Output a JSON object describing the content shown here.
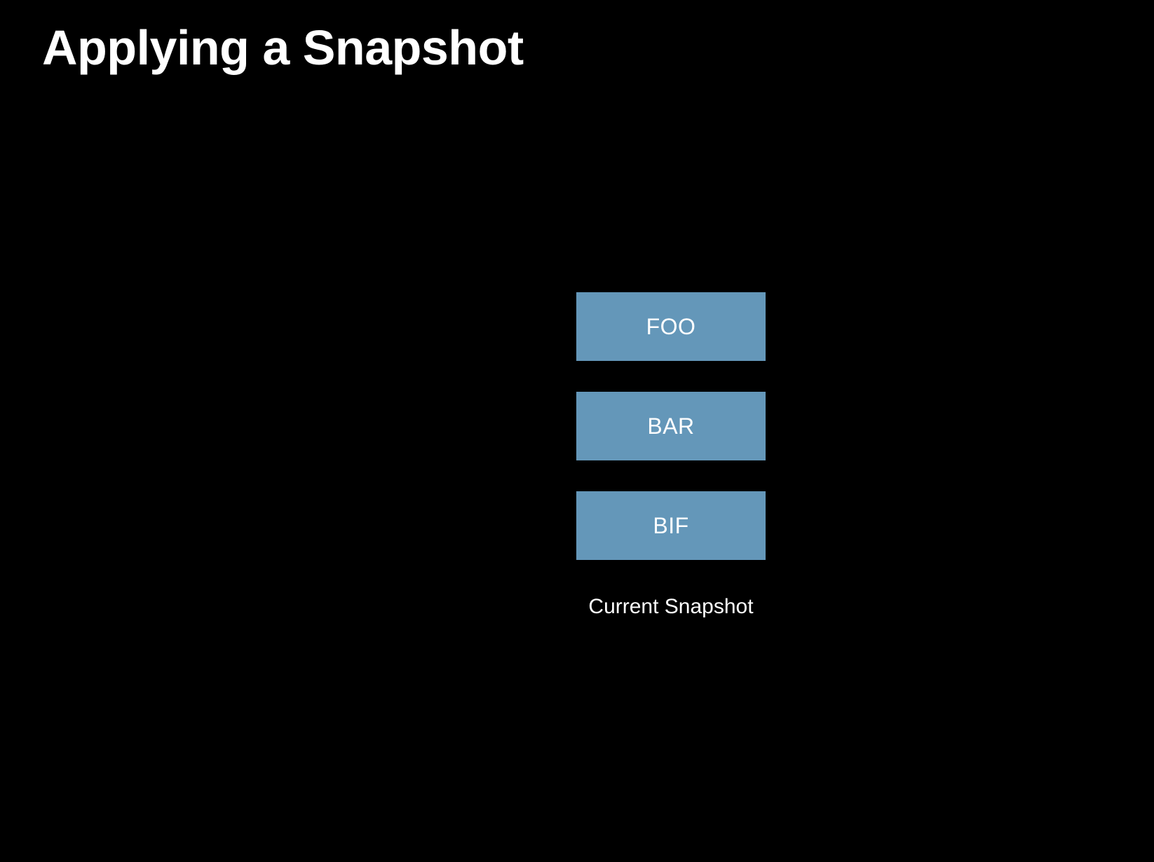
{
  "title": "Applying a Snapshot",
  "snapshot": {
    "items": [
      {
        "label": "FOO"
      },
      {
        "label": "BAR"
      },
      {
        "label": "BIF"
      }
    ],
    "caption": "Current Snapshot"
  },
  "colors": {
    "background": "#000000",
    "box_fill": "#6497b9",
    "text": "#ffffff"
  }
}
